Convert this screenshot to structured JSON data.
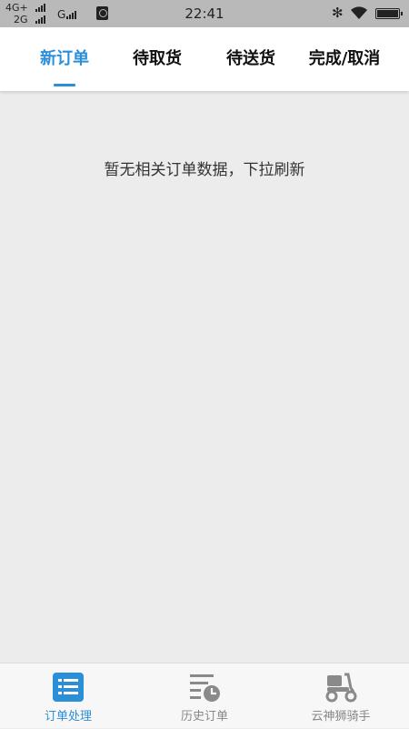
{
  "status_bar": {
    "network_top": "4G+",
    "network_bottom": "2G",
    "network_g": "G",
    "time": "22:41",
    "bluetooth_symbol": "✻"
  },
  "tabs": [
    {
      "label": "新订单",
      "active": true
    },
    {
      "label": "待取货",
      "active": false
    },
    {
      "label": "待送货",
      "active": false
    },
    {
      "label": "完成/取消",
      "active": false
    }
  ],
  "empty_message": "暂无相关订单数据，下拉刷新",
  "bottom_nav": [
    {
      "label": "订单处理",
      "icon": "order-list-icon",
      "active": true
    },
    {
      "label": "历史订单",
      "icon": "history-icon",
      "active": false
    },
    {
      "label": "云神狮骑手",
      "icon": "scooter-icon",
      "active": false
    }
  ],
  "colors": {
    "accent": "#2b8fd8",
    "background": "#ececec",
    "inactive_nav": "#888888",
    "status_bar": "#b9b9b9"
  }
}
